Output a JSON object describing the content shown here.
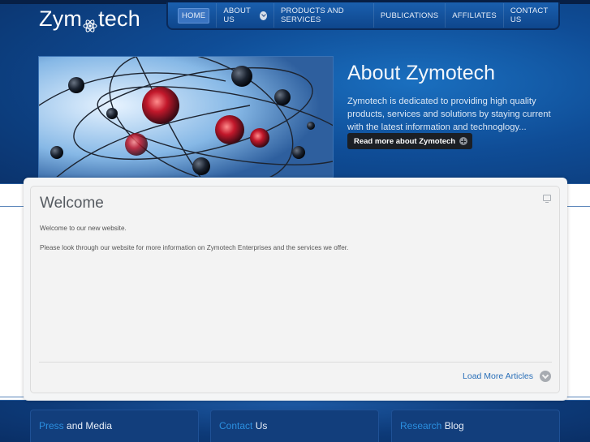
{
  "logo": {
    "text_before": "Zym",
    "text_after": "tech"
  },
  "nav": {
    "items": [
      {
        "label": "HOME",
        "active": true
      },
      {
        "label": "ABOUT US",
        "has_dropdown": true
      },
      {
        "label": "PRODUCTS AND SERVICES"
      },
      {
        "label": "PUBLICATIONS"
      },
      {
        "label": "AFFILIATES"
      },
      {
        "label": "CONTACT US"
      }
    ]
  },
  "hero": {
    "title": "About Zymotech",
    "text": "Zymotech is dedicated to providing high quality products, services and solutions by staying current with the latest information and technoglogy...",
    "button": "Read more about Zymotech"
  },
  "welcome": {
    "title": "Welcome",
    "line1": "Welcome to our new website.",
    "line2": "Please look through our website for more information on Zymotech Enterprises and the services we offer.",
    "load_more": "Load More Articles"
  },
  "footer_boxes": [
    {
      "highlight": "Press",
      "rest": " and Media"
    },
    {
      "highlight": "Contact",
      "rest": " Us"
    },
    {
      "highlight": "Research",
      "rest": " Blog"
    }
  ],
  "colors": {
    "accent": "#2a6fb8",
    "nav_bg": "#0e468c",
    "dark_button": "#1b1f25"
  }
}
